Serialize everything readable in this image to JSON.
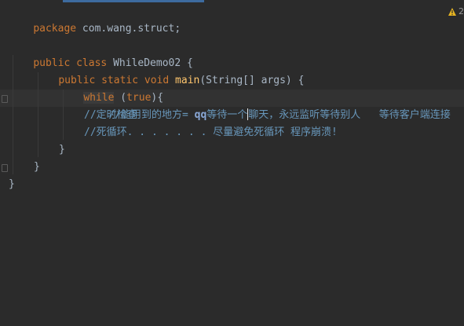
{
  "editor": {
    "warning_count": "2",
    "lines": {
      "l1": {
        "kw": "package",
        "rest": " com.wang.struct;"
      },
      "l2": {
        "kw1": "public",
        "kw2": "class",
        "rest": " WhileDemo02 {"
      },
      "l3": {
        "kw1": "public",
        "kw2": "static",
        "kw3": "void",
        "fn": "main",
        "rest": "(String[] args) {"
      },
      "l4": {
        "kw": "while",
        "paren_open": " (",
        "val": "true",
        "rest": "){"
      },
      "l5": {
        "prefix": "//能用到的地方= ",
        "qq": "qq",
        "mid": "等待一个",
        "after": "聊天，永远监听等待别人   等待客户端连接"
      },
      "l6": {
        "text": "//定时检查"
      },
      "l7": {
        "text": "//死循环. . . . . . . 尽量避免死循环 程序崩溃!"
      },
      "l8": {
        "text": "}"
      },
      "l9": {
        "text": "}"
      },
      "l10": {
        "text": "}"
      }
    }
  }
}
